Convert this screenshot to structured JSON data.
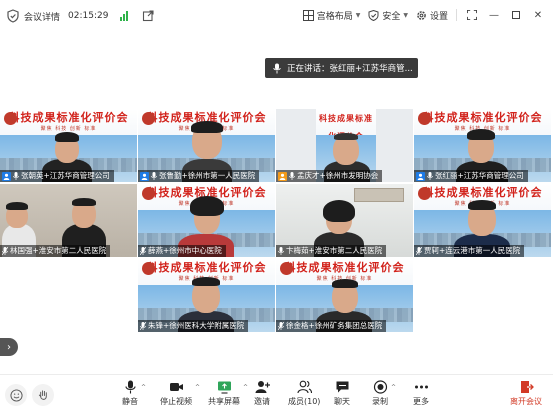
{
  "titlebar": {
    "title": "会议详情",
    "time": "02:15:29",
    "layout_label": "宫格布局",
    "security_label": "安全",
    "settings_label": "设置"
  },
  "speaking": {
    "text": "正在讲话：张红丽+江苏华商管..."
  },
  "banner": {
    "title": "科技成果标准化评价会",
    "subtitle": "聚焦 科技 创新 标准"
  },
  "tiles": [
    {
      "label": "张朝英+江苏华商管理公司"
    },
    {
      "label": "张鲁勤+徐州市第一人民医院"
    },
    {
      "label": "孟庆才+徐州市发明协会"
    },
    {
      "label": "张红丽+江苏华商管理公司"
    },
    {
      "label": "林国强+淮安市第二人民医院"
    },
    {
      "label": "薛燕+徐州市中心医院"
    },
    {
      "label": "卞梅茹+淮安市第二人民医院"
    },
    {
      "label": "贾轲+连云港市第一人民医院"
    },
    {
      "label": "朱锋+徐州医科大学附属医院"
    },
    {
      "label": "徐金格+徐州矿务集团总医院"
    }
  ],
  "toolbar": {
    "mute": "静音",
    "stop_video": "停止视频",
    "share_screen": "共享屏幕",
    "invite": "邀请",
    "members": "成员(10)",
    "chat": "聊天",
    "record": "录制",
    "more": "更多",
    "leave": "离开会议"
  },
  "colors": {
    "active_border": "#3ad07a",
    "leave_red": "#d23a26",
    "host_blue": "#1e7be6",
    "banner_red": "#d2231c"
  }
}
